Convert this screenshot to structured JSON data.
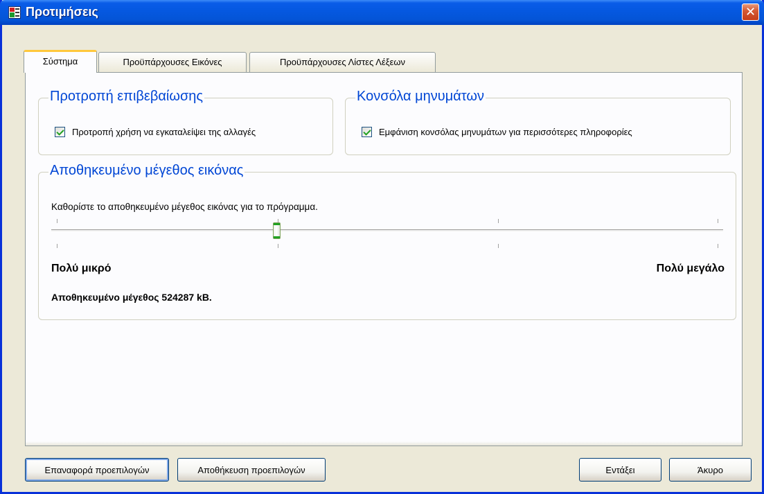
{
  "window": {
    "title": "Προτιμήσεις",
    "close_symbol": "✕"
  },
  "tabs": [
    {
      "label": "Σύστημα",
      "active": true
    },
    {
      "label": "Προϋπάρχουσες Εικόνες",
      "active": false
    },
    {
      "label": "Προϋπάρχουσες Λίστες Λέξεων",
      "active": false
    }
  ],
  "confirm_group": {
    "title": "Προτροπή επιβεβαίωσης",
    "checkbox_label": "Προτροπή χρήση να εγκαταλείψει της αλλαγές",
    "checked": true
  },
  "console_group": {
    "title": "Κονσόλα μηνυμάτων",
    "checkbox_label": "Εμφάνιση κονσόλας μηνυμάτων για περισσότερες πληροφορίες",
    "checked": true
  },
  "cache_group": {
    "title": "Αποθηκευμένο μέγεθος εικόνας",
    "description": "Καθορίστε το αποθηκευμένο μέγεθος εικόνας για το πρόγραμμα.",
    "slider": {
      "min_label": "Πολύ μικρό",
      "max_label": "Πολύ μεγάλο",
      "value_fraction": 0.34
    },
    "size_text": "Αποθηκευμένο μέγεθος 524287 kB."
  },
  "buttons": {
    "reset": "Επαναφορά προεπιλογών",
    "save": "Αποθήκευση προεπιλογών",
    "ok": "Εντάξει",
    "cancel": "Άκυρο"
  }
}
